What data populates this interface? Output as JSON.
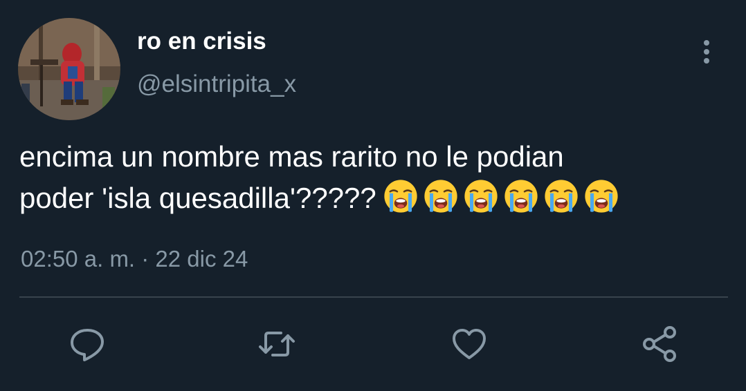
{
  "tweet": {
    "display_name": "ro en crisis",
    "handle": "@elsintripita_x",
    "text_line1": "encima un nombre mas rarito no le podian",
    "text_line2": "poder 'isla quesadilla'?????",
    "emoji_name": "loudly-crying-face",
    "emoji_count": 6,
    "timestamp": "02:50 a. m. · 22 dic 24"
  },
  "actions": {
    "reply_icon": "speech-bubble-icon",
    "retweet_icon": "retweet-arrows-icon",
    "like_icon": "heart-icon",
    "share_icon": "share-nodes-icon"
  },
  "colors": {
    "background": "#15202b",
    "secondary_text": "#8899a6",
    "divider": "#38444d",
    "icon": "#8899a6"
  }
}
